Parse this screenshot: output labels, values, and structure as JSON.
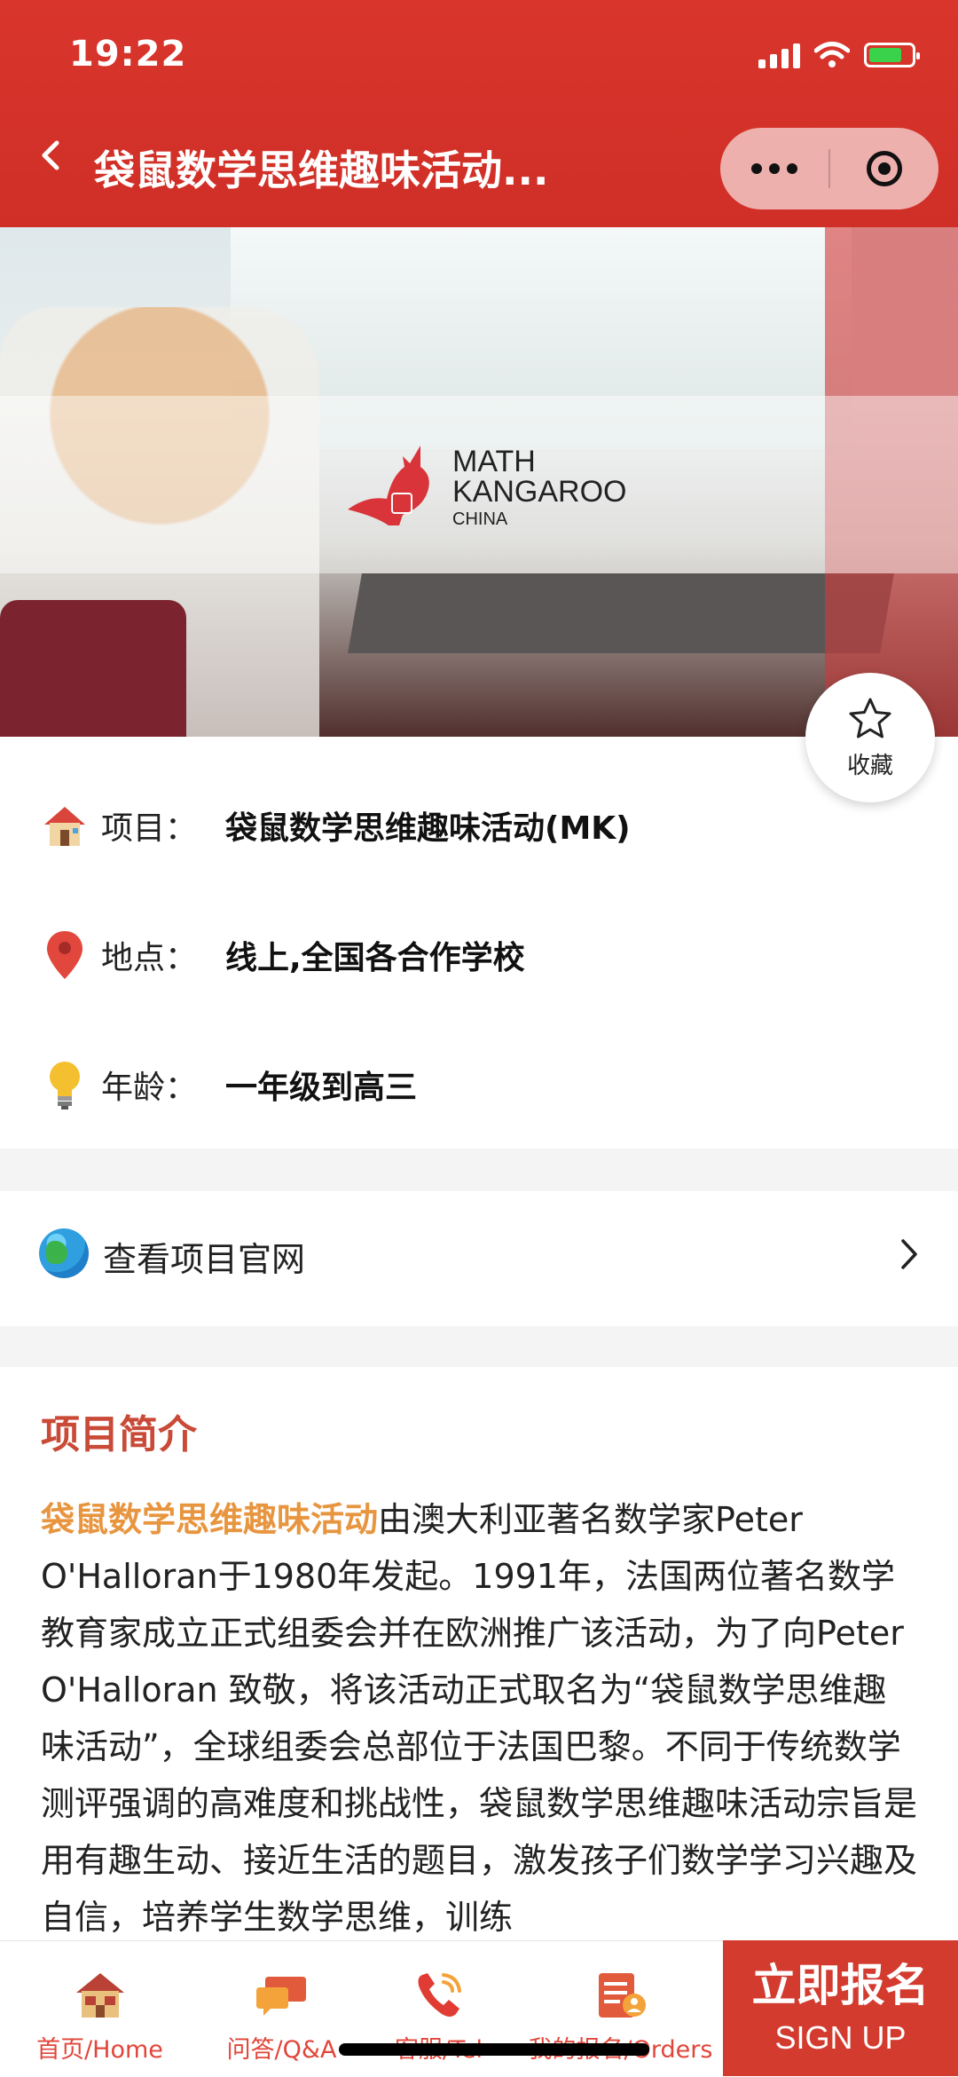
{
  "status_bar": {
    "time": "19:22"
  },
  "nav": {
    "title": "袋鼠数学思维趣味活动..."
  },
  "hero": {
    "logo_line1": "MATH",
    "logo_line2": "KANGAROO",
    "logo_line3": "CHINA"
  },
  "favorite": {
    "label": "收藏"
  },
  "info": {
    "project_label": "项目：",
    "project_value": "袋鼠数学思维趣味活动(MK)",
    "location_label": "地点：",
    "location_value": "线上,全国各合作学校",
    "age_label": "年龄：",
    "age_value": "一年级到高三"
  },
  "link": {
    "label": "查看项目官网"
  },
  "intro": {
    "heading": "项目简介",
    "highlight": "袋鼠数学思维趣味活动",
    "text": "由澳大利亚著名数学家Peter O'Halloran于1980年发起。1991年，法国两位著名数学教育家成立正式组委会并在欧洲推广该活动，为了向Peter O'Halloran 致敬，将该活动正式取名为“袋鼠数学思维趣味活动”，全球组委会总部位于法国巴黎。不同于传统数学测评强调的高难度和挑战性，袋鼠数学思维趣味活动宗旨是用有趣生动、接近生活的题目，激发孩子们数学学习兴趣及自信，培养学生数学思维，训练"
  },
  "tabbar": {
    "home": "首页/Home",
    "qa": "问答/Q&A",
    "tel": "客服/Tel",
    "orders": "我的报名/Orders",
    "signup_cn": "立即报名",
    "signup_en": "SIGN UP"
  },
  "colors": {
    "brand_red": "#d33b2f",
    "heading_red": "#c94a37",
    "highlight_orange": "#e8953f"
  }
}
